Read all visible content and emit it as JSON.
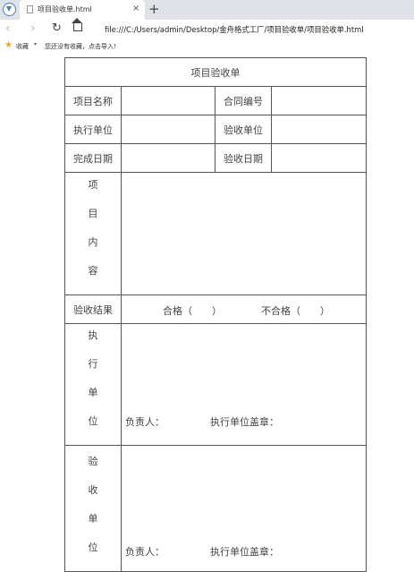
{
  "browser": {
    "tab_title": "项目验收单.html",
    "tab_close": "×",
    "new_tab": "+",
    "address": "file:///C:/Users/admin/Desktop/金舟格式工厂/项目验收单/项目验收单.html",
    "bookmarks_label": "收藏",
    "bookmarks_empty": "您还没有收藏，点击导入!"
  },
  "icons": {
    "back": "‹",
    "forward": "›",
    "reload": "↻",
    "star": "★",
    "arrow": "▾"
  },
  "form": {
    "title": "项目验收单",
    "project_name_label": "项目名称",
    "contract_no_label": "合同编号",
    "exec_unit_label": "执行单位",
    "accept_unit_label": "验收单位",
    "finish_date_label": "完成日期",
    "accept_date_label": "验收日期",
    "content_label": [
      "项",
      "目",
      "内",
      "容"
    ],
    "result_label": "验收结果",
    "pass_option": "合格（　　）",
    "fail_option": "不合格（　　）",
    "exec_section_label": [
      "执",
      "行",
      "单",
      "位"
    ],
    "accept_section_label": [
      "验",
      "收",
      "单",
      "位"
    ],
    "responsible_label": "负责人：",
    "exec_seal_label": "执行单位盖章："
  }
}
